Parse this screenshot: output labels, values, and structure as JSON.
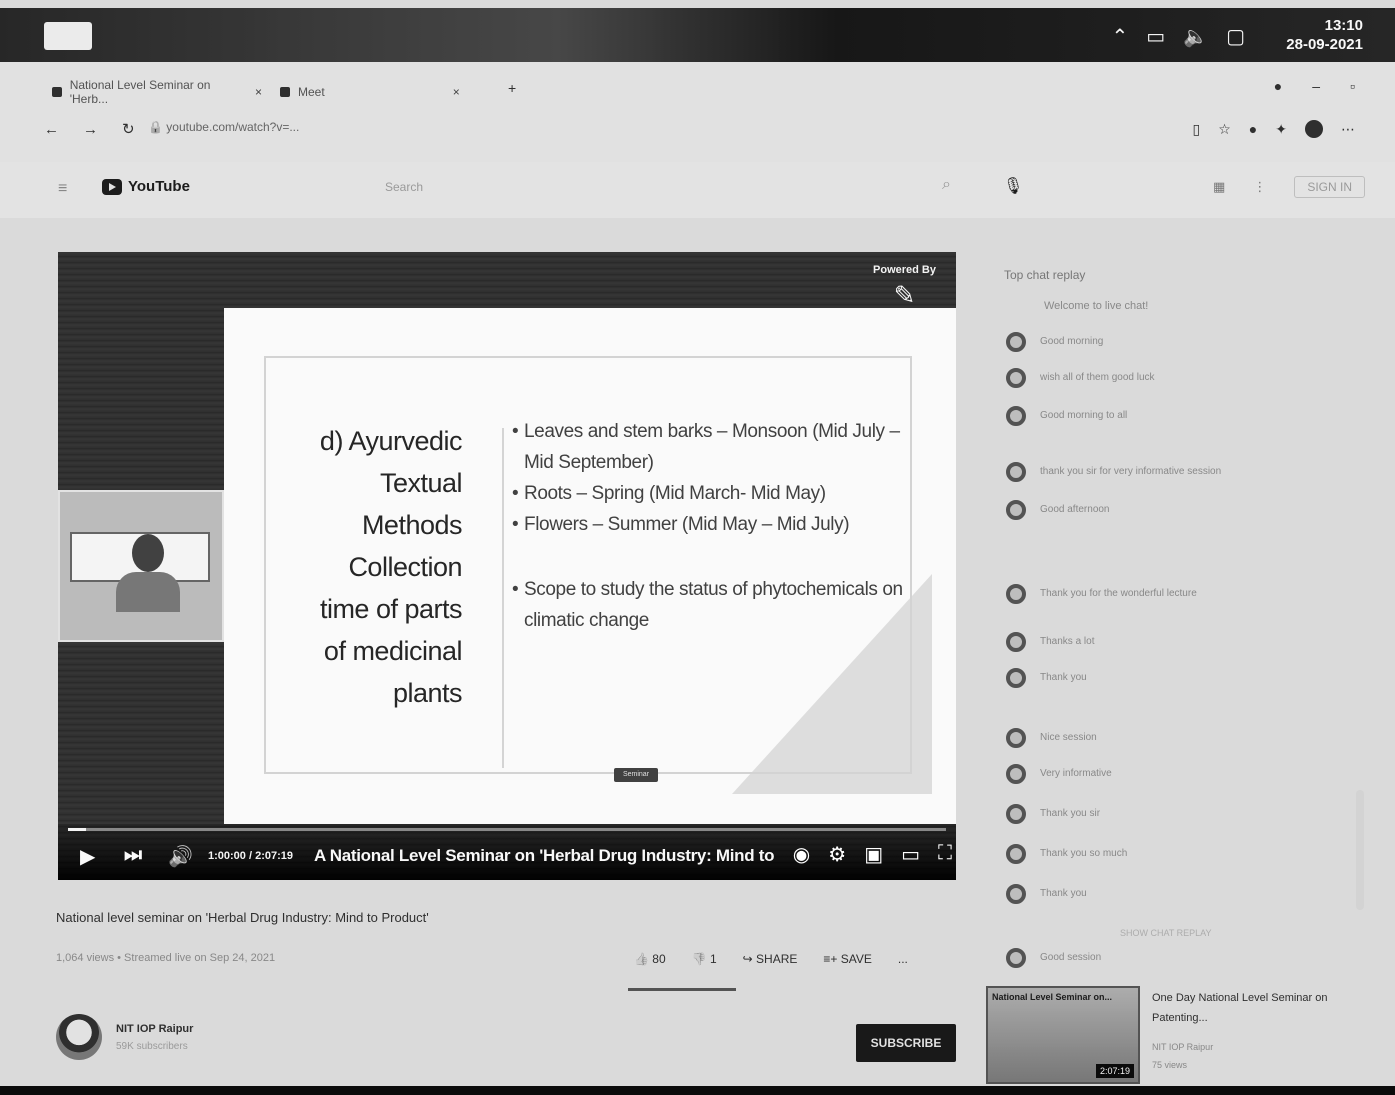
{
  "taskbar": {
    "clock_time": "13:10",
    "clock_date": "28-09-2021"
  },
  "browser": {
    "tabs": [
      {
        "label": "National Level Seminar on 'Herb...",
        "close": "×"
      },
      {
        "label": "Meet",
        "close": "×"
      }
    ],
    "url": "youtube.com/watch?v=..."
  },
  "youtube": {
    "logo_text": "YouTube",
    "search_placeholder": "Search",
    "signin_label": "SIGN IN"
  },
  "slide": {
    "badge": "Seminar",
    "title_lines": [
      "d) Ayurvedic",
      "Textual",
      "Methods",
      "Collection",
      "time of parts",
      "of medicinal",
      "plants"
    ],
    "bullets": [
      "Leaves and stem barks – Monsoon (Mid July – Mid September)",
      "Roots – Spring (Mid March- Mid May)",
      "Flowers – Summer (Mid May – Mid July)",
      "Scope to study the status of phytochemicals on climatic change"
    ]
  },
  "player": {
    "time": "1:00:00 / 2:07:19",
    "overlay_title": "A National Level Seminar on 'Herbal Drug Industry: Mind to Prod...",
    "progress": 0.02
  },
  "video": {
    "title": "National level seminar on 'Herbal Drug Industry: Mind to Product'",
    "meta": "1,064 views • Streamed live on Sep 24, 2021",
    "likes": "80",
    "dislikes": "1",
    "share_label": "SHARE",
    "save_label": "SAVE",
    "more_label": "..."
  },
  "channel": {
    "name": "NIT IOP Raipur",
    "subs": "59K subscribers",
    "subscribe_label": "SUBSCRIBE"
  },
  "chat": {
    "header": "Top chat replay",
    "subheader": "Welcome to live chat!",
    "messages": [
      "Good morning",
      "wish all of them good luck",
      "Good morning to all",
      "thank you sir for very informative session",
      "Good afternoon",
      "Thank you for the wonderful lecture",
      "Thanks a lot",
      "Thank you",
      "Nice session",
      "Very informative",
      "Thank you sir",
      "Thank you so much",
      "Thank you",
      "Good session"
    ],
    "show_more": "SHOW CHAT REPLAY"
  },
  "recommended": {
    "thumb_label": "National Level Seminar on...",
    "duration": "2:07:19",
    "title": "One Day National Level Seminar on Patenting...",
    "channel": "NIT IOP Raipur",
    "views": "75 views"
  }
}
